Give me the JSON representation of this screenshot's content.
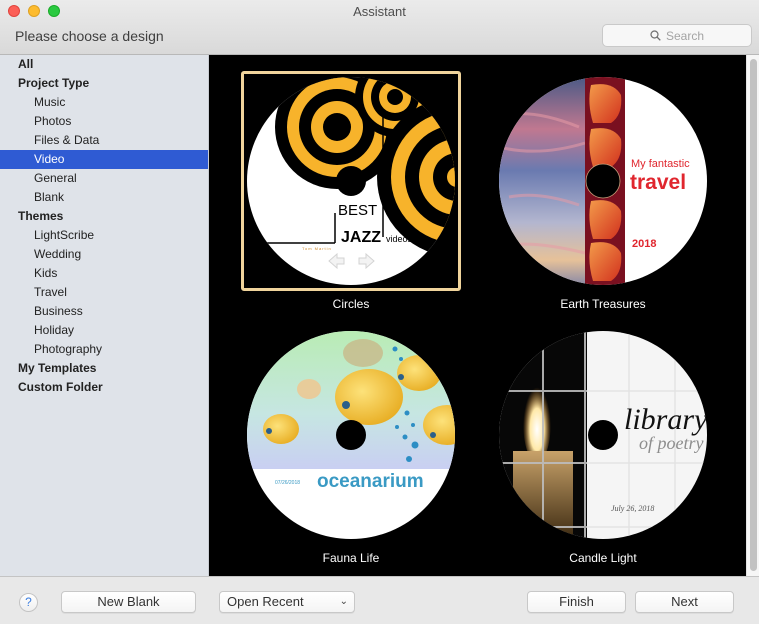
{
  "window": {
    "title": "Assistant",
    "subtitle": "Please choose a design"
  },
  "search": {
    "placeholder": "Search",
    "icon": "search-icon"
  },
  "sidebar": {
    "items": [
      {
        "label": "All",
        "level": "head",
        "selected": false
      },
      {
        "label": "Project Type",
        "level": "head",
        "selected": false
      },
      {
        "label": "Music",
        "level": "sub",
        "selected": false
      },
      {
        "label": "Photos",
        "level": "sub",
        "selected": false
      },
      {
        "label": "Files & Data",
        "level": "sub",
        "selected": false
      },
      {
        "label": "Video",
        "level": "sub",
        "selected": true
      },
      {
        "label": "General",
        "level": "sub",
        "selected": false
      },
      {
        "label": "Blank",
        "level": "sub",
        "selected": false
      },
      {
        "label": "Themes",
        "level": "head",
        "selected": false
      },
      {
        "label": "LightScribe",
        "level": "sub",
        "selected": false
      },
      {
        "label": "Wedding",
        "level": "sub",
        "selected": false
      },
      {
        "label": "Kids",
        "level": "sub",
        "selected": false
      },
      {
        "label": "Travel",
        "level": "sub",
        "selected": false
      },
      {
        "label": "Business",
        "level": "sub",
        "selected": false
      },
      {
        "label": "Holiday",
        "level": "sub",
        "selected": false
      },
      {
        "label": "Photography",
        "level": "sub",
        "selected": false
      },
      {
        "label": "My Templates",
        "level": "head",
        "selected": false
      },
      {
        "label": "Custom Folder",
        "level": "head",
        "selected": false
      }
    ]
  },
  "designs": [
    {
      "name": "Circles",
      "selected": true,
      "disc_text": {
        "line1": "BEST",
        "line2": "JAZZ",
        "line3": "videos",
        "author": "Tom Martin"
      },
      "colors": {
        "accent": "#f7b32b",
        "ink": "#000000"
      }
    },
    {
      "name": "Earth Treasures",
      "selected": false,
      "disc_text": {
        "line1": "My fantastic",
        "line2": "travel",
        "year": "2018"
      },
      "colors": {
        "accent": "#e0262e",
        "band": "#7a1020"
      }
    },
    {
      "name": "Fauna Life",
      "selected": false,
      "disc_text": {
        "date": "07/26/2018",
        "title": "oceanarium"
      },
      "colors": {
        "accent": "#3a9ac4",
        "fish": "#f3c42c"
      }
    },
    {
      "name": "Candle Light",
      "selected": false,
      "disc_text": {
        "line1": "library",
        "line2": "of poetry",
        "date": "July 26, 2018"
      },
      "colors": {
        "accent": "#222222"
      }
    }
  ],
  "footer": {
    "help_label": "?",
    "new_blank_label": "New Blank",
    "open_recent_label": "Open Recent",
    "finish_label": "Finish",
    "next_label": "Next"
  }
}
